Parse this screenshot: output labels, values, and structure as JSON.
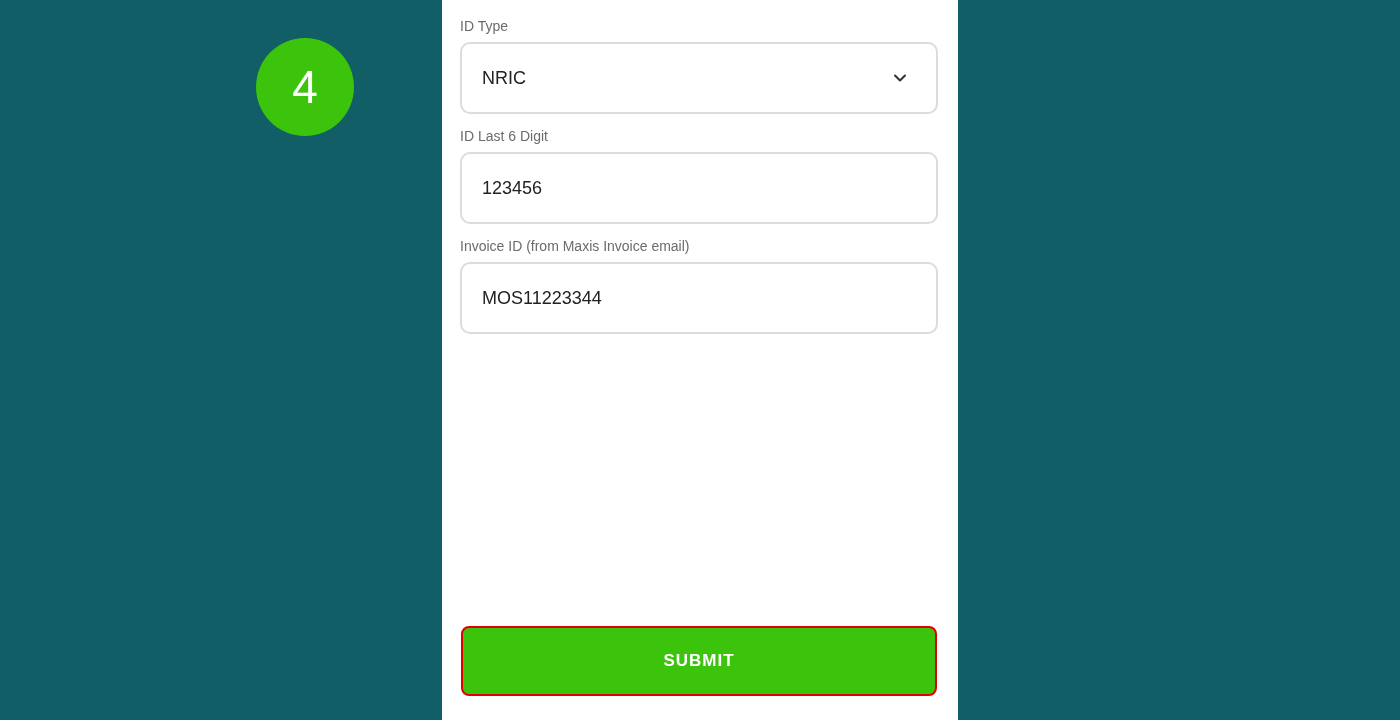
{
  "step_badge": "4",
  "fields": [
    {
      "kind": "select",
      "label": "ID Type",
      "value": "NRIC"
    },
    {
      "kind": "text",
      "label": "ID Last 6 Digit",
      "value": "123456"
    },
    {
      "kind": "text",
      "label": "Invoice ID (from Maxis Invoice email)",
      "value": "MOS11223344"
    }
  ],
  "submit": {
    "label": "SUBMIT",
    "highlighted": true
  }
}
